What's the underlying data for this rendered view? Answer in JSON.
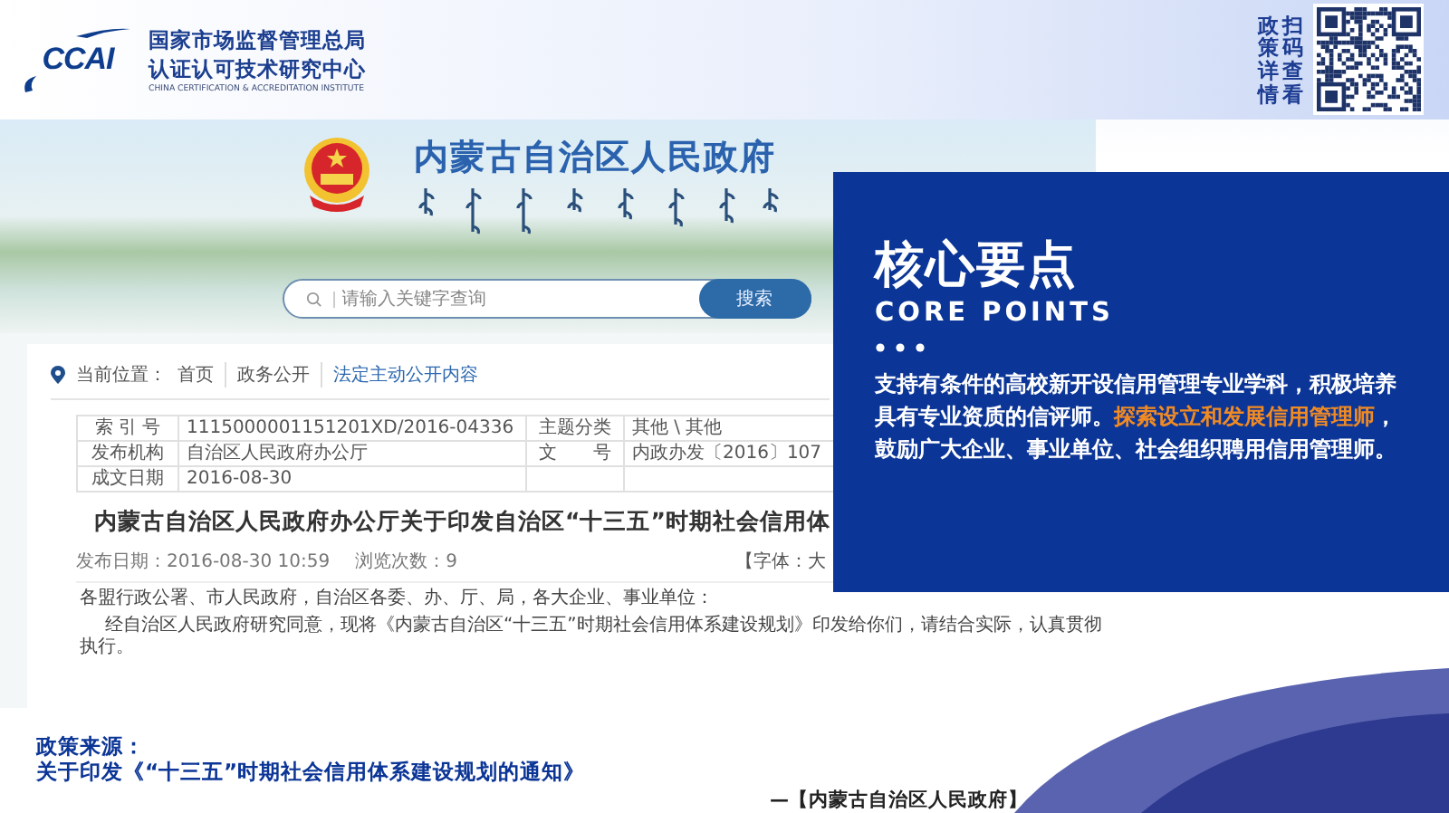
{
  "header": {
    "logo": "CCAI",
    "org_name_lines": [
      "国家市场监督管理总局",
      "认证认可技术研究中心"
    ],
    "org_name_en": "CHINA CERTIFICATION & ACCREDITATION INSTITUTE",
    "qr_caption_columns": [
      "政策详情",
      "扫码查看"
    ]
  },
  "screenshot": {
    "site_title": "内蒙古自治区人民政府",
    "search": {
      "placeholder": "请输入关键字查询",
      "button": "搜索"
    },
    "breadcrumb": {
      "label": "当前位置：",
      "items": [
        {
          "label": "首页",
          "selected": false
        },
        {
          "label": "政务公开",
          "selected": false
        },
        {
          "label": "法定主动公开内容",
          "selected": true
        }
      ]
    },
    "info_table": [
      [
        "索 引 号",
        "1115000001151201XD/2016-04336",
        "主题分类",
        "其他 \\ 其他"
      ],
      [
        "发布机构",
        "自治区人民政府办公厅",
        "文　　号",
        "内政办发〔2016〕107"
      ],
      [
        "成文日期",
        "2016-08-30"
      ]
    ],
    "article": {
      "title": "内蒙古自治区人民政府办公厅关于印发自治区“十三五”时期社会信用体",
      "meta": [
        "发布日期：2016-08-30 10:59",
        "浏览次数：9"
      ],
      "font_size_label": "【字体：大",
      "salutation": "各盟行政公署、市人民政府，自治区各委、办、厅、局，各大企业、事业单位：",
      "body": "经自治区人民政府研究同意，现将《内蒙古自治区“十三五”时期社会信用体系建设规划》印发给你们，请结合实际，认真贯彻执行。"
    }
  },
  "core_points": {
    "title": "核心要点",
    "subtitle": "CORE POINTS",
    "segments": [
      {
        "text": "支持有条件的高校新开设信用管理专业学科，积极培养具有专业资质的信评师。",
        "highlight": false
      },
      {
        "text": "探索设立和发展信用管理师",
        "highlight": true
      },
      {
        "text": "，鼓励广大企业、事业单位、社会组织聘用信用管理师。",
        "highlight": false
      }
    ]
  },
  "source": {
    "label": "政策来源：",
    "title": "关于印发《“十三五”时期社会信用体系建设规划的通知》",
    "attribution": "—【内蒙古自治区人民政府】"
  }
}
